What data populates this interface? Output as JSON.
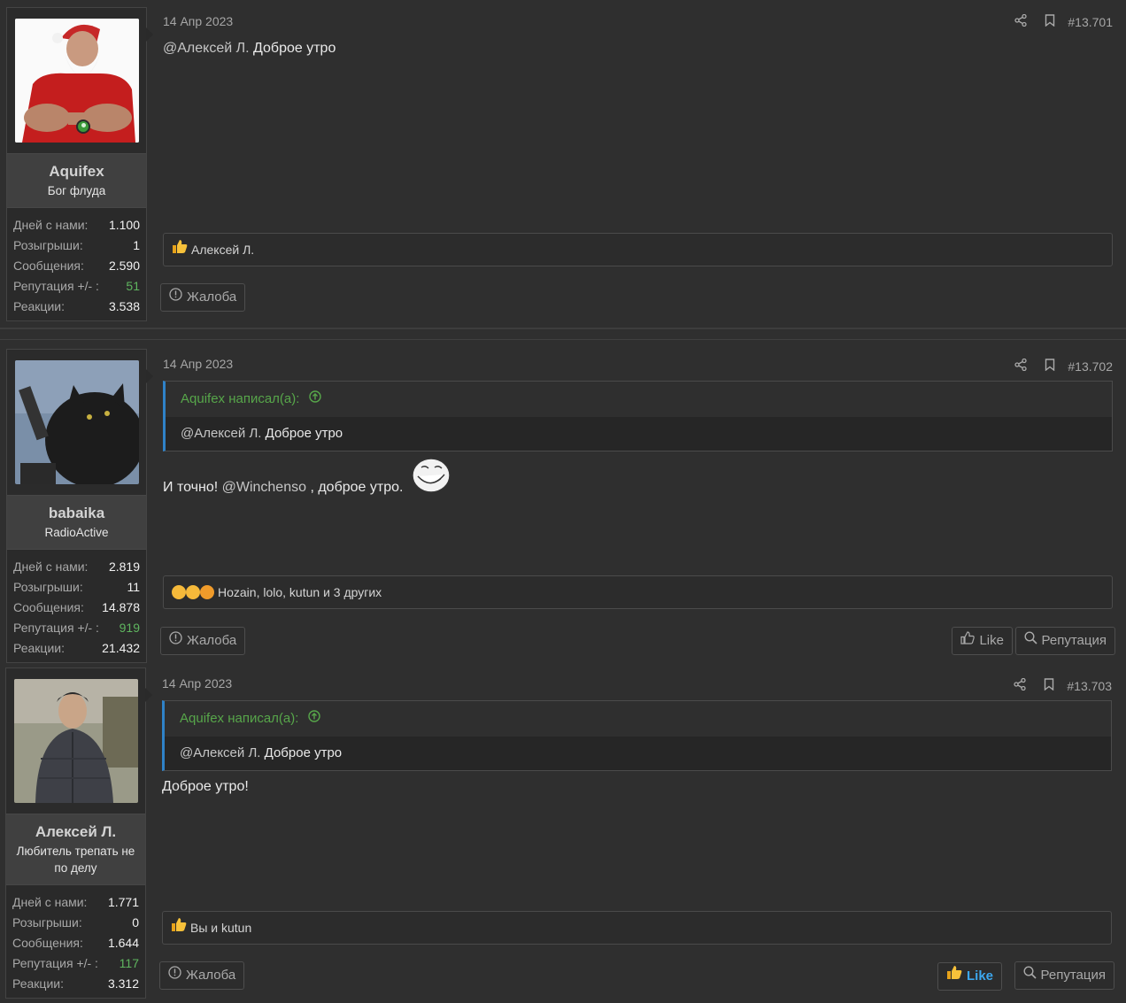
{
  "posts": [
    {
      "user": {
        "name": "Aquifex",
        "title": "Бог флуда",
        "stats": [
          {
            "label": "Дней с нами:",
            "value": "1.100"
          },
          {
            "label": "Розыгрыши:",
            "value": "1"
          },
          {
            "label": "Сообщения:",
            "value": "2.590"
          },
          {
            "label": "Репутация +/- :",
            "value": "51"
          },
          {
            "label": "Реакции:",
            "value": "3.538"
          }
        ]
      },
      "date": "14 Апр 2023",
      "number": "#13.701",
      "mention": "@Алексей Л.",
      "text": " Доброе утро",
      "reactions": "Алексей Л.",
      "report": "Жалоба"
    },
    {
      "user": {
        "name": "babaika",
        "title": "RadioActive",
        "stats": [
          {
            "label": "Дней с нами:",
            "value": "2.819"
          },
          {
            "label": "Розыгрыши:",
            "value": "11"
          },
          {
            "label": "Сообщения:",
            "value": "14.878"
          },
          {
            "label": "Репутация +/- :",
            "value": "919"
          },
          {
            "label": "Реакции:",
            "value": "21.432"
          }
        ]
      },
      "date": "14 Апр 2023",
      "number": "#13.702",
      "quote_author": "Aquifex написал(а):",
      "quote_mention": "@Алексей Л.",
      "quote_text": " Доброе утро",
      "text_before": "И точно! ",
      "mention": "@Winchenso",
      "text_after": " , доброе утро.",
      "reactions": "Hozain, lolo, kutun и 3 других",
      "report": "Жалоба",
      "like": "Like",
      "rep": "Репутация"
    },
    {
      "user": {
        "name": "Алексей Л.",
        "title": "Любитель трепать не по делу",
        "stats": [
          {
            "label": "Дней с нами:",
            "value": "1.771"
          },
          {
            "label": "Розыгрыши:",
            "value": "0"
          },
          {
            "label": "Сообщения:",
            "value": "1.644"
          },
          {
            "label": "Репутация +/- :",
            "value": "117"
          },
          {
            "label": "Реакции:",
            "value": "3.312"
          }
        ]
      },
      "date": "14 Апр 2023",
      "number": "#13.703",
      "quote_author": "Aquifex написал(а):",
      "quote_mention": "@Алексей Л.",
      "quote_text": " Доброе утро",
      "text": "Доброе утро!",
      "reactions": "Вы и kutun",
      "report": "Жалоба",
      "like": "Like",
      "rep": "Репутация"
    }
  ],
  "colors": {
    "background": "#2f2f2f",
    "accent_blue": "#3ca7ee",
    "quote_green": "#57a64a",
    "reputation_green": "#5fb55f"
  }
}
